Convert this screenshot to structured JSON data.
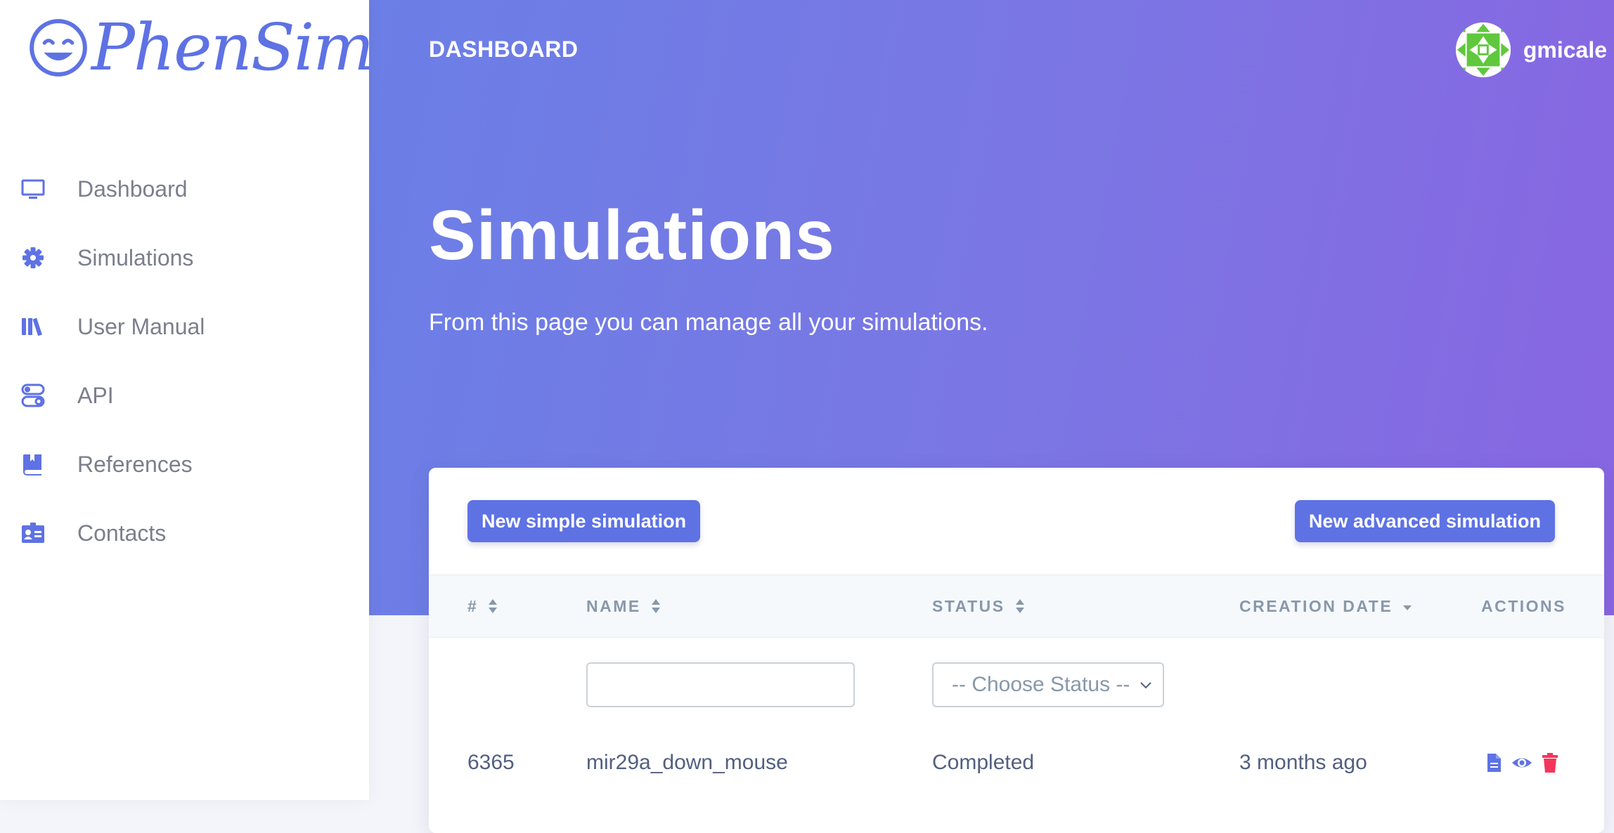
{
  "brand": {
    "name": "PhenSim"
  },
  "sidebar": {
    "items": [
      {
        "label": "Dashboard",
        "icon": "monitor-icon"
      },
      {
        "label": "Simulations",
        "icon": "gear-icon"
      },
      {
        "label": "User Manual",
        "icon": "books-icon"
      },
      {
        "label": "API",
        "icon": "toggles-icon"
      },
      {
        "label": "References",
        "icon": "book-icon"
      },
      {
        "label": "Contacts",
        "icon": "id-card-icon"
      }
    ]
  },
  "header": {
    "section": "DASHBOARD",
    "username": "gmicale"
  },
  "page": {
    "title": "Simulations",
    "subtitle": "From this page you can manage all your simulations."
  },
  "toolbar": {
    "new_simple": "New simple simulation",
    "new_advanced": "New advanced simulation"
  },
  "table": {
    "columns": [
      "#",
      "NAME",
      "STATUS",
      "CREATION DATE",
      "ACTIONS"
    ],
    "filters": {
      "name_value": "",
      "status_placeholder": "-- Choose Status --"
    },
    "rows": [
      {
        "id": "6365",
        "name": "mir29a_down_mouse",
        "status": "Completed",
        "created": "3 months ago"
      }
    ]
  },
  "colors": {
    "accent": "#5e72e4",
    "danger": "#f5365c",
    "gradient_start": "#6b7fe6",
    "gradient_end": "#8866e2"
  }
}
